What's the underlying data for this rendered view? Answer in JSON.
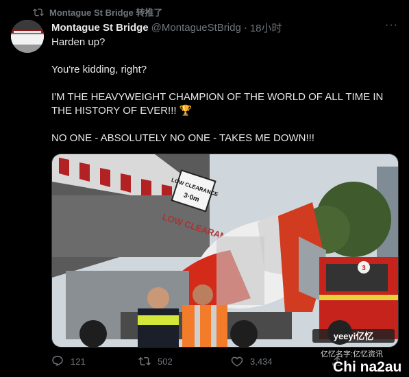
{
  "retweet": {
    "label": "Montague St Bridge 转推了",
    "icon": "retweet-icon"
  },
  "tweet": {
    "author_name": "Montague St Bridge",
    "author_handle": "@MontagueStBridg",
    "separator": "·",
    "time": "18小时",
    "more_label": "···",
    "lines": [
      "Harden up?",
      "You're kidding, right?",
      "I'M THE HEAVYWEIGHT CHAMPION OF THE WORLD OF ALL TIME IN THE HISTORY OF EVER!!! 🏆",
      "NO ONE - ABSOLUTELY NO ONE - TAKES ME DOWN!!!"
    ],
    "media": {
      "sign1": "LOW CLEARANCE",
      "sign2": "3·0m",
      "bridge_text": "LOW CLEARANCE",
      "truck_number": "3",
      "watermark": "yeeyi亿忆"
    },
    "actions": {
      "reply_count": "121",
      "retweet_count": "502",
      "like_count": "3,434"
    }
  },
  "watermark": {
    "line1": "亿忆名字:亿忆资讯",
    "line2": "Chi na2au"
  },
  "colors": {
    "background": "#000000",
    "text": "#e7e9ea",
    "secondary": "#71767b"
  }
}
